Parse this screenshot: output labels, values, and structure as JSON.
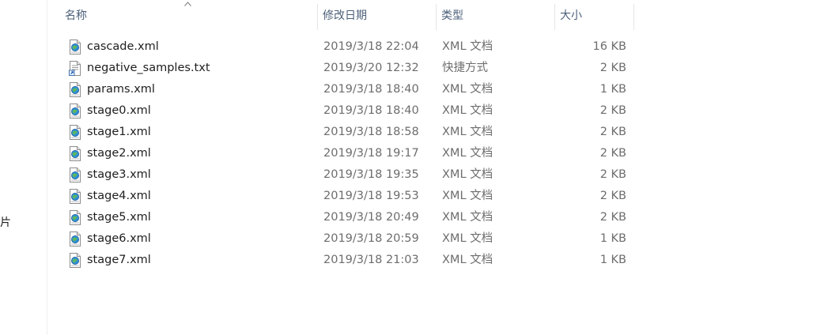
{
  "left_pane": {
    "fragment": "片"
  },
  "columns": [
    {
      "key": "name",
      "label": "名称"
    },
    {
      "key": "date",
      "label": "修改日期"
    },
    {
      "key": "type",
      "label": "类型"
    },
    {
      "key": "size",
      "label": "大小"
    }
  ],
  "files": [
    {
      "name": "cascade.xml",
      "date": "2019/3/18 22:04",
      "type": "XML 文档",
      "size": "16 KB",
      "icon": "xml-file-icon"
    },
    {
      "name": "negative_samples.txt",
      "date": "2019/3/20 12:32",
      "type": "快捷方式",
      "size": "2 KB",
      "icon": "shortcut-file-icon"
    },
    {
      "name": "params.xml",
      "date": "2019/3/18 18:40",
      "type": "XML 文档",
      "size": "1 KB",
      "icon": "xml-file-icon"
    },
    {
      "name": "stage0.xml",
      "date": "2019/3/18 18:40",
      "type": "XML 文档",
      "size": "2 KB",
      "icon": "xml-file-icon"
    },
    {
      "name": "stage1.xml",
      "date": "2019/3/18 18:58",
      "type": "XML 文档",
      "size": "2 KB",
      "icon": "xml-file-icon"
    },
    {
      "name": "stage2.xml",
      "date": "2019/3/18 19:17",
      "type": "XML 文档",
      "size": "2 KB",
      "icon": "xml-file-icon"
    },
    {
      "name": "stage3.xml",
      "date": "2019/3/18 19:35",
      "type": "XML 文档",
      "size": "2 KB",
      "icon": "xml-file-icon"
    },
    {
      "name": "stage4.xml",
      "date": "2019/3/18 19:53",
      "type": "XML 文档",
      "size": "2 KB",
      "icon": "xml-file-icon"
    },
    {
      "name": "stage5.xml",
      "date": "2019/3/18 20:49",
      "type": "XML 文档",
      "size": "2 KB",
      "icon": "xml-file-icon"
    },
    {
      "name": "stage6.xml",
      "date": "2019/3/18 20:59",
      "type": "XML 文档",
      "size": "1 KB",
      "icon": "xml-file-icon"
    },
    {
      "name": "stage7.xml",
      "date": "2019/3/18 21:03",
      "type": "XML 文档",
      "size": "1 KB",
      "icon": "xml-file-icon"
    }
  ],
  "colors": {
    "header_text": "#4c607a",
    "name_text": "#1e1e1e",
    "detail_text": "#6d6d6d",
    "separator": "#e5e5e5"
  }
}
